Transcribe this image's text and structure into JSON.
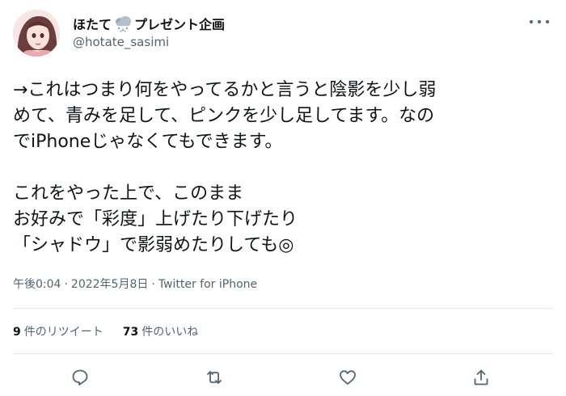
{
  "tweet": {
    "display_name": "ほたて",
    "display_name_suffix": "プレゼント企画",
    "handle": "@hotate_sasimi",
    "lines": [
      "→これはつまり何をやってるかと言うと陰影を少し弱",
      "めて、青みを足して、ピンクを少し足してます。なの",
      "でiPhoneじゃなくてもできます。",
      "",
      "これをやった上で、このまま",
      "お好みで「彩度」上げたり下げたり",
      "「シャドウ」で影弱めたりしても◎"
    ],
    "time": "午後0:04",
    "date": "2022年5月8日",
    "source": "Twitter for iPhone",
    "meta_separator": "·"
  },
  "stats": {
    "retweets_count": "9",
    "retweets_label": "件のリツイート",
    "likes_count": "73",
    "likes_label": "件のいいね"
  },
  "icons": {
    "more": "more-options-icon",
    "reply": "reply-icon",
    "retweet": "retweet-icon",
    "like": "heart-icon",
    "share": "share-icon",
    "weather": "snow-cloud-icon"
  },
  "colors": {
    "text": "#0f1419",
    "secondary": "#536471",
    "divider": "#e4e7ea"
  }
}
